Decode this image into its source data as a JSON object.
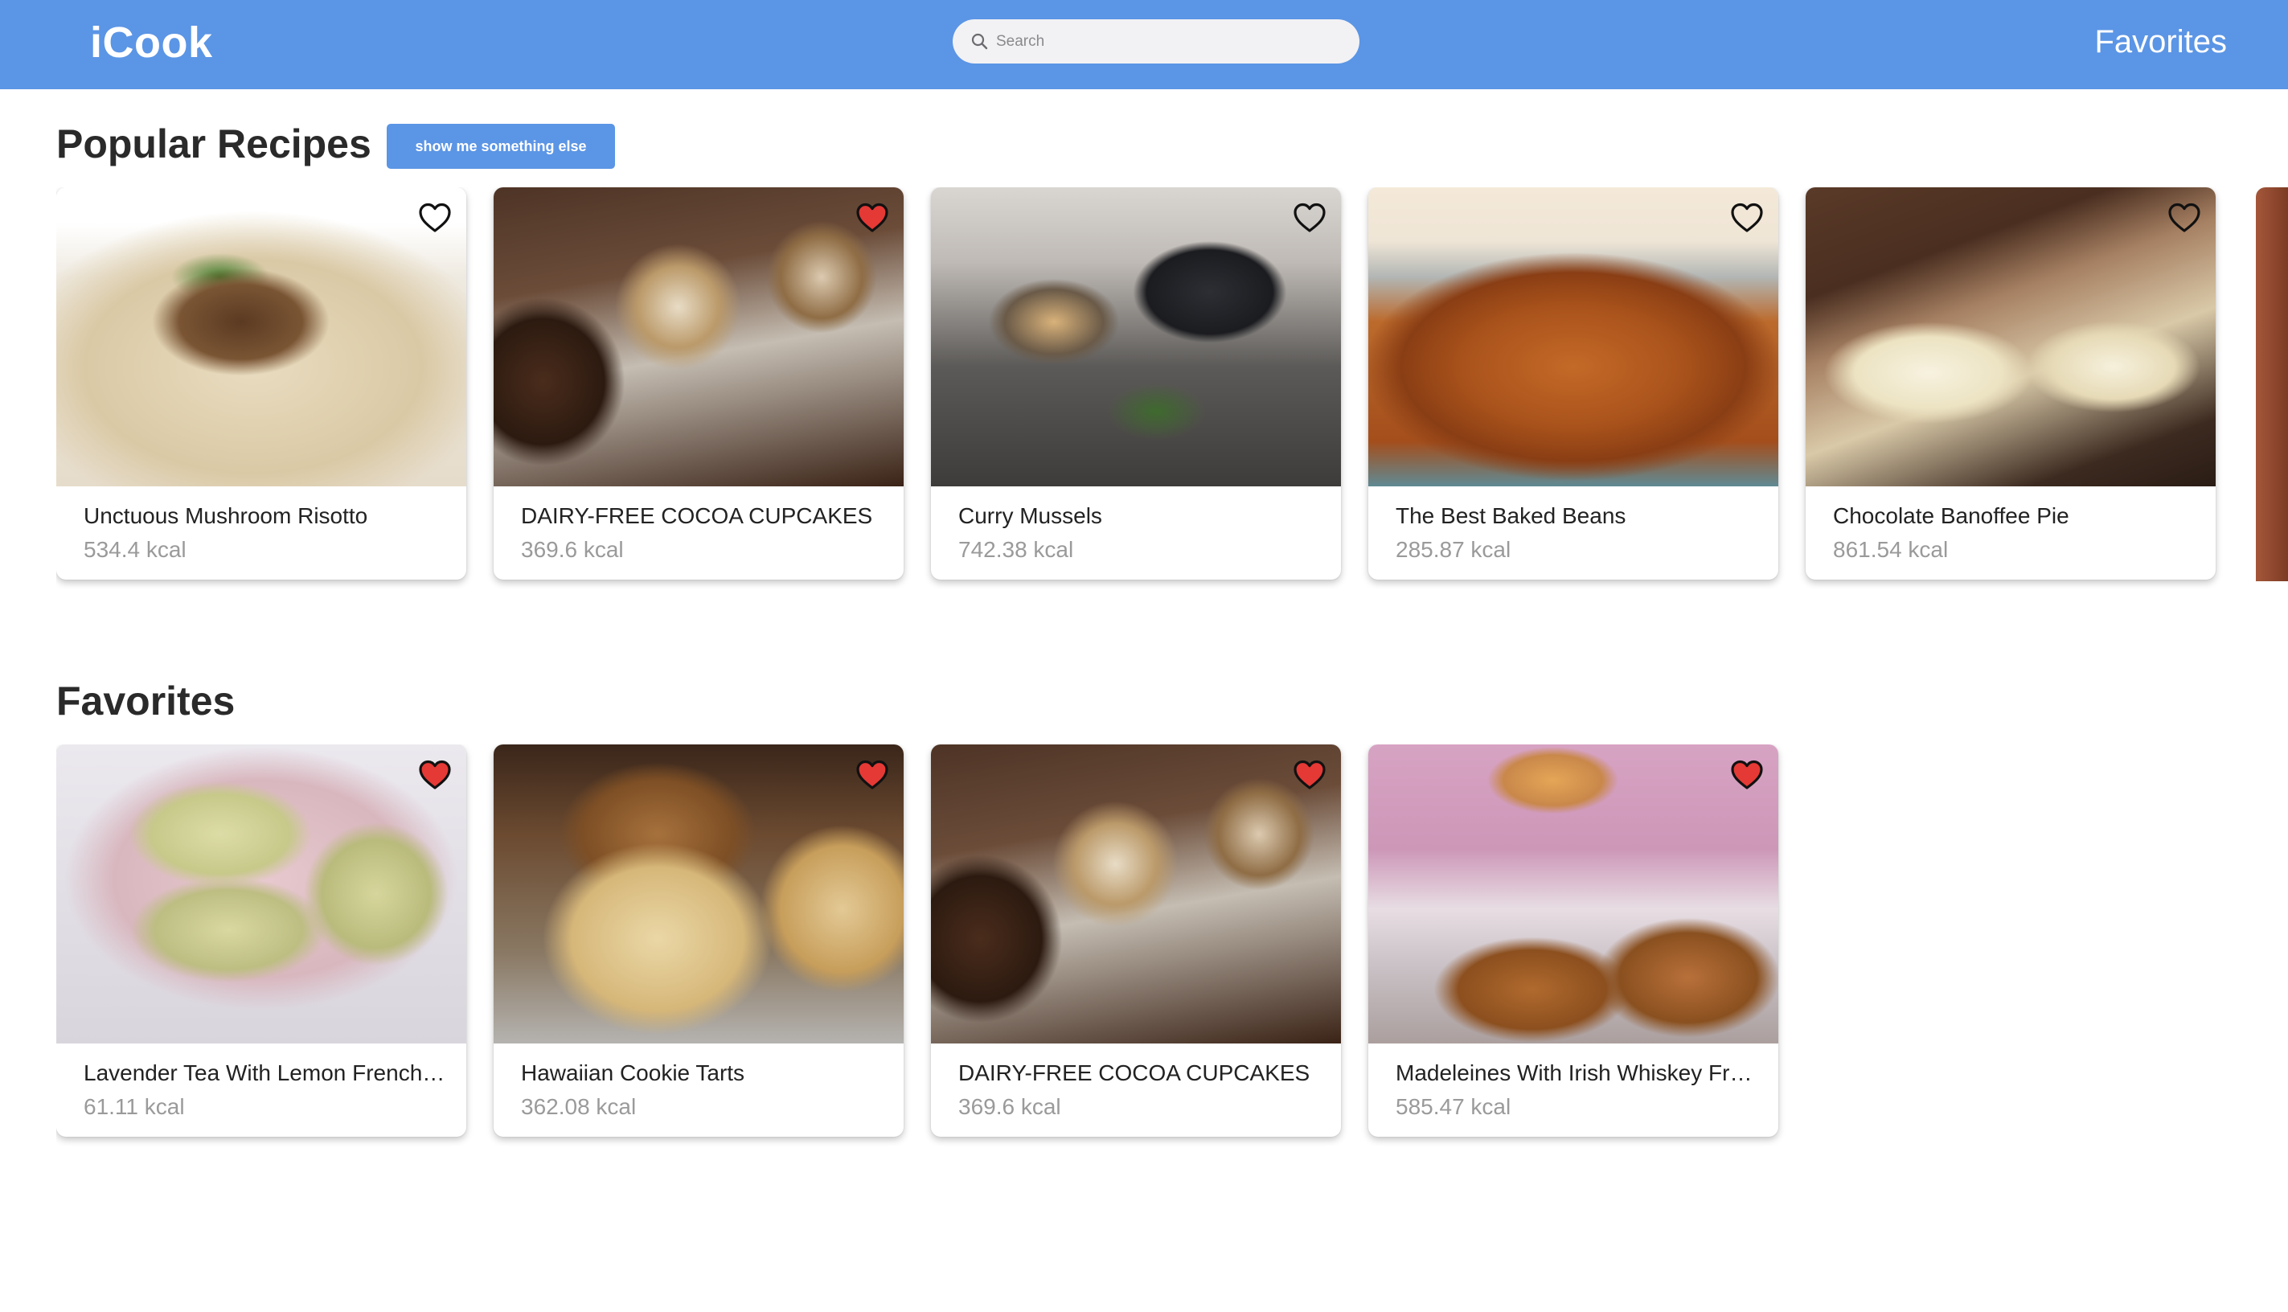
{
  "header": {
    "logo": "iCook",
    "search_placeholder": "Search",
    "nav_favorites": "Favorites",
    "color": "#5b95e5"
  },
  "popular": {
    "title": "Popular Recipes",
    "button_label": "show me something else",
    "cards": [
      {
        "title": "Unctuous Mushroom Risotto",
        "kcal": "534.4 kcal",
        "favorited": false,
        "image": "mushroom-risotto"
      },
      {
        "title": "DAIRY-FREE COCOA CUPCAKES",
        "kcal": "369.6 kcal",
        "favorited": true,
        "image": "cocoa-cupcakes"
      },
      {
        "title": "Curry Mussels",
        "kcal": "742.38 kcal",
        "favorited": false,
        "image": "curry-mussels"
      },
      {
        "title": "The Best Baked Beans",
        "kcal": "285.87 kcal",
        "favorited": false,
        "image": "baked-beans"
      },
      {
        "title": "Chocolate Banoffee Pie",
        "kcal": "861.54 kcal",
        "favorited": false,
        "image": "banoffee-pie"
      }
    ]
  },
  "favorites": {
    "title": "Favorites",
    "cards": [
      {
        "title": "Lavender Tea With Lemon French Macarons",
        "kcal": "61.11 kcal",
        "favorited": true,
        "image": "lavender-macarons"
      },
      {
        "title": "Hawaiian Cookie Tarts",
        "kcal": "362.08 kcal",
        "favorited": true,
        "image": "cookie-tarts"
      },
      {
        "title": "DAIRY-FREE COCOA CUPCAKES",
        "kcal": "369.6 kcal",
        "favorited": true,
        "image": "cocoa-cupcakes"
      },
      {
        "title": "Madeleines With Irish Whiskey Frosting",
        "kcal": "585.47 kcal",
        "favorited": true,
        "image": "madeleines"
      }
    ]
  },
  "colors": {
    "accent": "#5b95e5",
    "heart_active": "#e53935",
    "kcal_text": "#9a9a9a"
  }
}
